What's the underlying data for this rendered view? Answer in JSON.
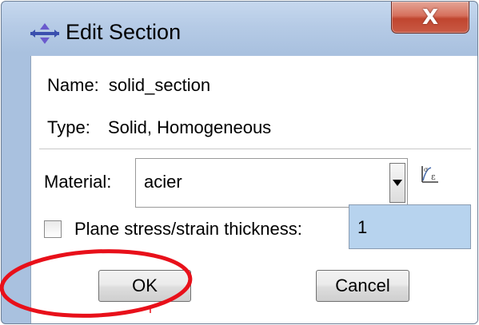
{
  "window": {
    "title": "Edit Section",
    "close_glyph": "X",
    "title_icon": "section-icon"
  },
  "section": {
    "name_label": "Name:",
    "name_value": "solid_section",
    "type_label": "Type:",
    "type_value": "Solid, Homogeneous"
  },
  "material": {
    "label": "Material:",
    "selected": "acier",
    "manager_icon": "material-manager-icon"
  },
  "thickness": {
    "checked": false,
    "label": "Plane stress/strain thickness:",
    "value": "1"
  },
  "buttons": {
    "ok": "OK",
    "cancel": "Cancel"
  },
  "colors": {
    "title_bar": "#b6cbe6",
    "close_button": "#c95a45",
    "input_highlight": "#b7d3ee",
    "annotation": "#e8101a"
  }
}
